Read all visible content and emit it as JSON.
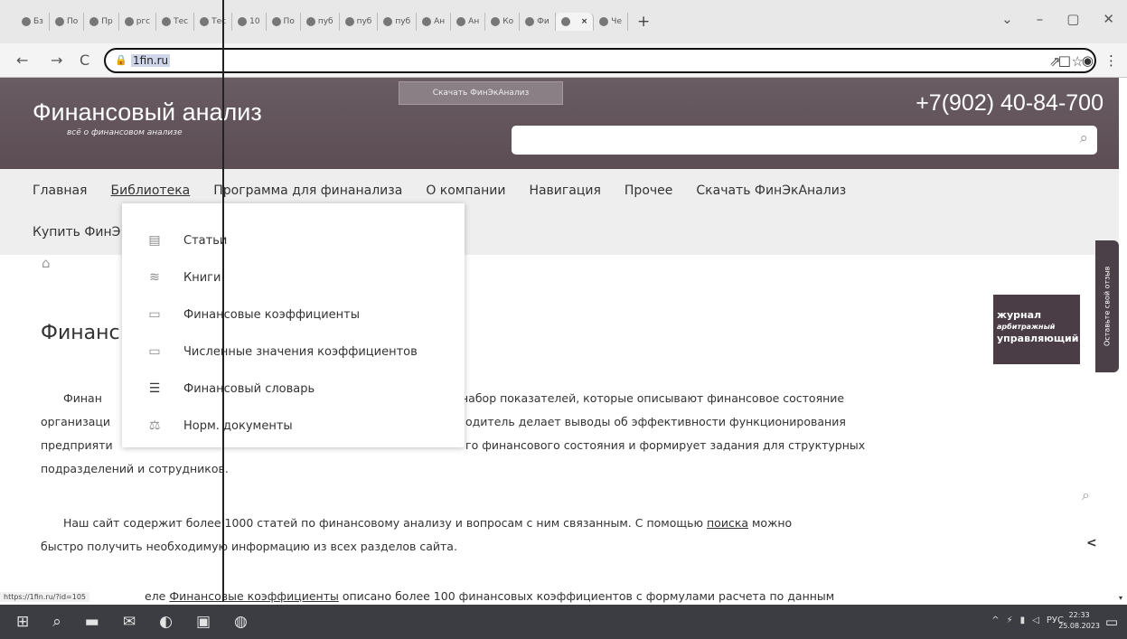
{
  "browser": {
    "tabs": [
      "Бз",
      "По",
      "Пр",
      "ргс",
      "Тес",
      "Тес",
      "10",
      "По",
      "пуб",
      "пуб",
      "пуб",
      "Ан",
      "Ан",
      "Ко",
      "Фи",
      "",
      "Че"
    ],
    "active_tab_close": "×",
    "new_tab": "+",
    "window_controls": [
      "⌄",
      "–",
      "▢",
      "✕"
    ],
    "nav": {
      "back": "←",
      "forward": "→",
      "reload": "C"
    },
    "url": "1fin.ru",
    "omnibox_icons": [
      "⇗",
      "☆"
    ],
    "ext_icons": [
      "□",
      "◉",
      "⋮"
    ]
  },
  "site": {
    "title": "Финансовый анализ",
    "tagline": "всё о финансовом анализе",
    "download_button": "Скачать ФинЭкАнализ",
    "phone": "+7(902) 40-84-700",
    "search_placeholder": ""
  },
  "nav": {
    "items": [
      "Главная",
      "Библиотека",
      "Программа для финанализа",
      "О компании",
      "Навигация",
      "Прочее",
      "Скачать ФинЭкАнализ"
    ],
    "row2": "Купить ФинЭ"
  },
  "dropdown": {
    "items": [
      {
        "label": "Статьи",
        "icon": "document-icon"
      },
      {
        "label": "Книги",
        "icon": "books-icon"
      },
      {
        "label": "Финансовые коэффициенты",
        "icon": "table-icon"
      },
      {
        "label": "Численные значения коэффициентов",
        "icon": "table-icon"
      },
      {
        "label": "Финансовый словарь",
        "icon": "list-icon"
      },
      {
        "label": "Норм. документы",
        "icon": "scales-icon"
      }
    ]
  },
  "article": {
    "heading": "Финанс",
    "p1_line1_left": "Финан",
    "p1_line1_right": "набор показателей, которые описывают финансовое состояние",
    "p1_line2_left": "организаци",
    "p1_line2_right": "одитель делает выводы об эффективности функционирования",
    "p1_line3_left": "предприяти",
    "p1_line3_right": "го финансового состояния и формирует задания для структурных",
    "p1_line4": "подразделений и сотрудников.",
    "p2_a": "Наш сайт содержит более 1000 статей по финансовому анализу и вопросам с ним связанным. С помощью ",
    "p2_link": "поиска",
    "p2_b": " можно",
    "p2_line2": "быстро получить необходимую информацию из всех разделов сайта.",
    "p3_pre": "еле ",
    "p3_link": "Финансовые коэффициенты",
    "p3_post": " описано более 100 финансовых коэффициентов с формулами расчета по данным",
    "status_url": "https://1fin.ru/?id=105"
  },
  "sidebar": {
    "journal_line1": "журнал",
    "journal_line2": "арбитражный",
    "journal_line3": "управляющий",
    "feedback": "Оставьте свой отзыв"
  },
  "taskbar": {
    "lang": "РУС",
    "time": "22:33",
    "date": "25.08.2023"
  }
}
